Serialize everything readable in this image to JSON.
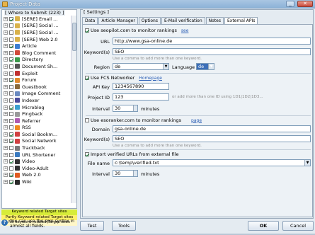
{
  "window": {
    "title": "Project Data",
    "minimize_glyph": "_",
    "close_glyph": "✕"
  },
  "left_panel": {
    "group_title": "[ Where to Submit (223) ]",
    "tree": [
      {
        "label": "[SERE] Email ...",
        "expander": "+",
        "checked": true,
        "icon_color": "#d9b24a"
      },
      {
        "label": "[SERE] Social ...",
        "expander": "+",
        "checked": false,
        "icon_color": "#d9b24a"
      },
      {
        "label": "[SERE] Social ...",
        "expander": "+",
        "checked": false,
        "icon_color": "#d9b24a"
      },
      {
        "label": "[SERE] Web 2.0",
        "expander": "+",
        "checked": false,
        "icon_color": "#d9b24a"
      },
      {
        "label": "Article",
        "expander": "+",
        "checked": true,
        "icon_color": "#3c7fd1"
      },
      {
        "label": "Blog Comment",
        "expander": "+",
        "checked": false,
        "icon_color": "#d04a3a"
      },
      {
        "label": "Directory",
        "expander": "+",
        "checked": true,
        "icon_color": "#3a9a4a"
      },
      {
        "label": "Document Sh...",
        "expander": "+",
        "checked": false,
        "icon_color": "#555555"
      },
      {
        "label": "Exploit",
        "expander": "+",
        "checked": false,
        "icon_color": "#c03030"
      },
      {
        "label": "Forum",
        "expander": "+",
        "checked": true,
        "icon_color": "#e08a2a"
      },
      {
        "label": "Guestbook",
        "expander": "+",
        "checked": false,
        "icon_color": "#8a6a3a"
      },
      {
        "label": "Image Comment",
        "expander": "+",
        "checked": false,
        "icon_color": "#6a8ac0"
      },
      {
        "label": "Indexer",
        "expander": "+",
        "checked": false,
        "icon_color": "#4a4a9a"
      },
      {
        "label": "Microblog",
        "expander": "+",
        "checked": true,
        "icon_color": "#3aa0d0"
      },
      {
        "label": "Pingback",
        "expander": "+",
        "checked": false,
        "icon_color": "#9a9a9a"
      },
      {
        "label": "Referrer",
        "expander": "+",
        "checked": false,
        "icon_color": "#b05ab0"
      },
      {
        "label": "RSS",
        "expander": "+",
        "checked": false,
        "icon_color": "#f08a20"
      },
      {
        "label": "Social Bookm...",
        "expander": "+",
        "checked": true,
        "icon_color": "#d04040"
      },
      {
        "label": "Social Network",
        "expander": "+",
        "checked": true,
        "icon_color": "#d04040"
      },
      {
        "label": "Trackback",
        "expander": "+",
        "checked": false,
        "icon_color": "#7a7a7a"
      },
      {
        "label": "URL Shortener",
        "expander": "+",
        "checked": false,
        "icon_color": "#3a7ac0"
      },
      {
        "label": "Video",
        "expander": "+",
        "checked": true,
        "icon_color": "#333333"
      },
      {
        "label": "Video-Adult",
        "expander": "+",
        "checked": false,
        "icon_color": "#333333"
      },
      {
        "label": "Web 2.0",
        "expander": "+",
        "checked": true,
        "icon_color": "#e05a20"
      },
      {
        "label": "Wiki",
        "expander": "+",
        "checked": true,
        "icon_color": "#2a2a2a"
      }
    ],
    "legend": [
      {
        "text": "Keyword related Target sites",
        "color": "#d7ec39"
      },
      {
        "text": "Partly Keyword related Target sites",
        "color": "#fff16a"
      },
      {
        "text": "No keyword related Target sites",
        "color": "#fff7c8"
      }
    ],
    "info_text": "You can use the spin syntax in almost all fields.",
    "info_glyph": "?"
  },
  "settings": {
    "group_title": "[ Settings ]",
    "tabs": [
      "Data",
      "Article Manager",
      "Options",
      "E-Mail verification",
      "Notes",
      "External APIs"
    ],
    "active_tab": "External APIs",
    "seopilot": {
      "enable_label": "Use seopilot.com to monitor rankings",
      "enable_link": "see",
      "url_label": "URL",
      "url_value": "http://www.gsa-online.de",
      "keyword_label": "Keyword(s)",
      "keyword_value": "SEO",
      "keyword_hint": "Use a comma to add more than one keyword.",
      "region_label": "Region",
      "region_value": "de",
      "language_label": "Language",
      "language_value": "de"
    },
    "fcs": {
      "enable_label": "Use FCS Networker",
      "enable_link": "Homepage",
      "api_key_label": "API Key",
      "api_key_value": "1234567890",
      "project_id_label": "Project ID",
      "project_id_value": "123",
      "project_id_hint": "or add more than one ID using 1D1|1D2|1D3...",
      "interval_label": "Interval",
      "interval_value": "30",
      "interval_unit": "minutes"
    },
    "esoranker": {
      "enable_label": "Use esoranker.com to monitor rankings",
      "enable_link": "page",
      "domain_label": "Domain",
      "domain_value": "gsa-online.de",
      "keyword_label": "Keyword(s)",
      "keyword_value": "SEO",
      "keyword_hint": "Use a comma to add more than one keyword."
    },
    "import": {
      "enable_label": "Import verified URLs from external file",
      "file_label": "File name",
      "file_value": "c:\\temp\\verified.txt",
      "interval_label": "Interval",
      "interval_value": "30",
      "interval_unit": "minutes"
    }
  },
  "buttons": {
    "test": "Test",
    "tools": "Tools",
    "ok": "OK",
    "cancel": "Cancel"
  }
}
